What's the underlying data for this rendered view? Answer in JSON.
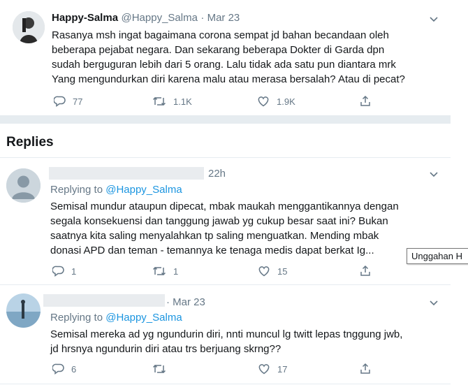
{
  "main_tweet": {
    "display_name": "Happy-Salma",
    "handle": "@Happy_Salma",
    "date": "· Mar 23",
    "text": "Rasanya msh ingat bagaimana corona sempat jd bahan becandaan oleh\nbeberapa pejabat negara. Dan sekarang beberapa Dokter di Garda dpn\nsudah berguguran lebih dari 5 orang. Lalu tidak ada satu pun diantara mrk\nYang mengundurkan diri karena malu atau merasa bersalah? Atau di pecat?",
    "reply_count": "77",
    "retweet_count": "1.1K",
    "like_count": "1.9K"
  },
  "replies_heading": "Replies",
  "replies": [
    {
      "date": "22h",
      "replying_label": "Replying to ",
      "replying_handle": "@Happy_Salma",
      "text": "Semisal mundur ataupun dipecat, mbak maukah menggantikannya dengan\nsegala konsekuensi dan tanggung jawab yg cukup besar saat ini? Bukan\nsaatnya kita saling menyalahkan tp saling menguatkan. Mending mbak\ndonasi APD dan teman - temannya ke tenaga medis dapat berkat Ig...",
      "reply_count": "1",
      "retweet_count": "1",
      "like_count": "15"
    },
    {
      "date": "· Mar 23",
      "replying_label": "Replying to ",
      "replying_handle": "@Happy_Salma",
      "text": "Semisal mereka ad yg ngundurin diri, nnti muncul lg twitt lepas tnggung jwb,\njd hrsnya ngundurin diri atau trs berjuang skrng??",
      "reply_count": "6",
      "retweet_count": "",
      "like_count": "17"
    }
  ],
  "tooltip": "Unggahan H",
  "colors": {
    "accent": "#1b95e0",
    "muted": "#657786",
    "divider": "#e6ecf0"
  },
  "icons": [
    "reply-icon",
    "retweet-icon",
    "like-icon",
    "share-icon",
    "chevron-down-icon"
  ]
}
